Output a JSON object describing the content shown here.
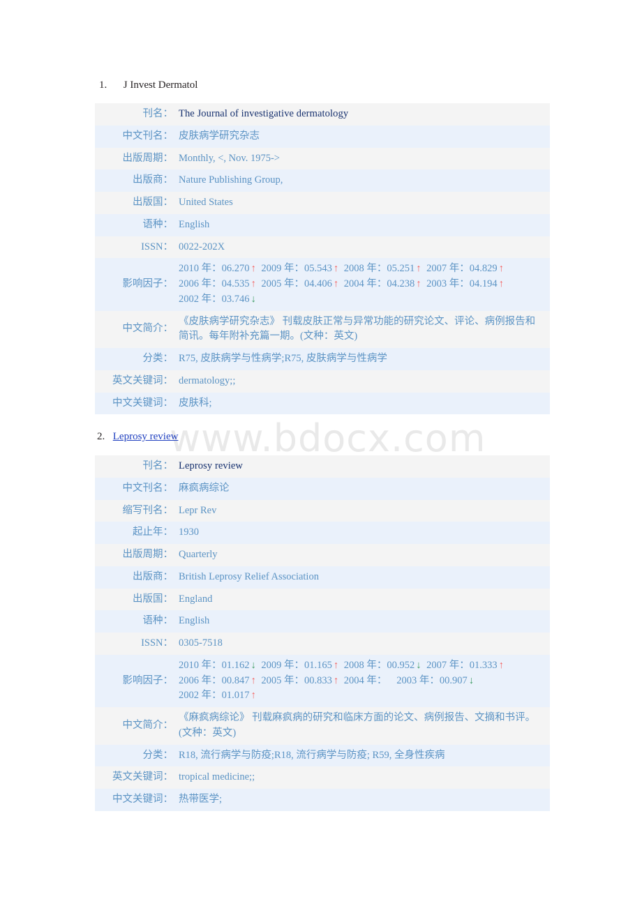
{
  "watermark": "www.bdocx.com",
  "labels": {
    "journal_name": "刊名：",
    "chinese_name": "中文刊名：",
    "abbrev_name": "缩写刊名：",
    "start_year": "起止年：",
    "frequency": "出版周期：",
    "publisher": "出版商：",
    "country": "出版国：",
    "language": "语种：",
    "issn": "ISSN：",
    "impact_factor": "影响因子：",
    "chinese_intro": "中文简介：",
    "category": "分类：",
    "en_keywords": "英文关键词：",
    "cn_keywords": "中文关键词："
  },
  "colors": {
    "label": "#5b93c4",
    "value": "#5b93c4",
    "title": "#16306e",
    "link": "#1f3fbf",
    "up_arrow": "#f4615f",
    "down_arrow": "#3d9b63",
    "row_odd": "#f4f4f4",
    "row_even": "#eaf1fb",
    "watermark": "#e9e9e9"
  },
  "entries": [
    {
      "number": "1.",
      "heading": "J Invest Dermatol",
      "heading_is_link": false,
      "rows": [
        {
          "key": "journal_name",
          "label": "刊名：",
          "value": "The Journal of investigative dermatology",
          "style": "title"
        },
        {
          "key": "chinese_name",
          "label": "中文刊名：",
          "value": "皮肤病学研究杂志"
        },
        {
          "key": "frequency",
          "label": "出版周期：",
          "value": "Monthly, <, Nov. 1975->"
        },
        {
          "key": "publisher",
          "label": "出版商：",
          "value": "Nature Publishing Group,"
        },
        {
          "key": "country",
          "label": "出版国：",
          "value": "United States"
        },
        {
          "key": "language",
          "label": "语种：",
          "value": "English"
        },
        {
          "key": "issn",
          "label": "ISSN：",
          "value": "0022-202X"
        }
      ],
      "impact_factor": {
        "label": "影响因子：",
        "points": [
          {
            "year": "2010",
            "value": "06.270",
            "trend": "up"
          },
          {
            "year": "2009",
            "value": "05.543",
            "trend": "up"
          },
          {
            "year": "2008",
            "value": "05.251",
            "trend": "up"
          },
          {
            "year": "2007",
            "value": "04.829",
            "trend": "up"
          },
          {
            "year": "2006",
            "value": "04.535",
            "trend": "up"
          },
          {
            "year": "2005",
            "value": "04.406",
            "trend": "up"
          },
          {
            "year": "2004",
            "value": "04.238",
            "trend": "up"
          },
          {
            "year": "2003",
            "value": "04.194",
            "trend": "up"
          },
          {
            "year": "2002",
            "value": "03.746",
            "trend": "down"
          }
        ]
      },
      "intro": {
        "label": "中文简介：",
        "value": "《皮肤病学研究杂志》 刊载皮肤正常与异常功能的研究论文、评论、病例报告和简讯。每年附补充篇一期。(文种：英文)"
      },
      "category": {
        "label": "分类：",
        "value": "R75, 皮肤病学与性病学;R75, 皮肤病学与性病学"
      },
      "en_keywords": {
        "label": "英文关键词：",
        "value": "dermatology;;"
      },
      "cn_keywords": {
        "label": "中文关键词：",
        "value": "皮肤科;"
      }
    },
    {
      "number": "2.",
      "heading": "Leprosy review",
      "heading_is_link": true,
      "rows": [
        {
          "key": "journal_name",
          "label": "刊名：",
          "value": "Leprosy review",
          "style": "title"
        },
        {
          "key": "chinese_name",
          "label": "中文刊名：",
          "value": "麻疯病综论"
        },
        {
          "key": "abbrev_name",
          "label": "缩写刊名：",
          "value": "Lepr Rev"
        },
        {
          "key": "start_year",
          "label": "起止年：",
          "value": "1930"
        },
        {
          "key": "frequency",
          "label": "出版周期：",
          "value": "Quarterly"
        },
        {
          "key": "publisher",
          "label": "出版商：",
          "value": "British Leprosy Relief Association"
        },
        {
          "key": "country",
          "label": "出版国：",
          "value": "England"
        },
        {
          "key": "language",
          "label": "语种：",
          "value": "English"
        },
        {
          "key": "issn",
          "label": "ISSN：",
          "value": "0305-7518"
        }
      ],
      "impact_factor": {
        "label": "影响因子：",
        "points": [
          {
            "year": "2010",
            "value": "01.162",
            "trend": "down"
          },
          {
            "year": "2009",
            "value": "01.165",
            "trend": "up"
          },
          {
            "year": "2008",
            "value": "00.952",
            "trend": "down"
          },
          {
            "year": "2007",
            "value": "01.333",
            "trend": "up"
          },
          {
            "year": "2006",
            "value": "00.847",
            "trend": "up"
          },
          {
            "year": "2005",
            "value": "00.833",
            "trend": "up"
          },
          {
            "year": "2004",
            "value": "",
            "trend": "none"
          },
          {
            "year": "2003",
            "value": "00.907",
            "trend": "down"
          },
          {
            "year": "2002",
            "value": "01.017",
            "trend": "up"
          }
        ]
      },
      "intro": {
        "label": "中文简介：",
        "value": "《麻疯病综论》 刊载麻疯病的研究和临床方面的论文、病例报告、文摘和书评。(文种：英文)"
      },
      "category": {
        "label": "分类：",
        "value": "R18, 流行病学与防疫;R18, 流行病学与防疫; R59, 全身性疾病"
      },
      "en_keywords": {
        "label": "英文关键词：",
        "value": "tropical medicine;;"
      },
      "cn_keywords": {
        "label": "中文关键词：",
        "value": "热带医学;"
      }
    }
  ]
}
